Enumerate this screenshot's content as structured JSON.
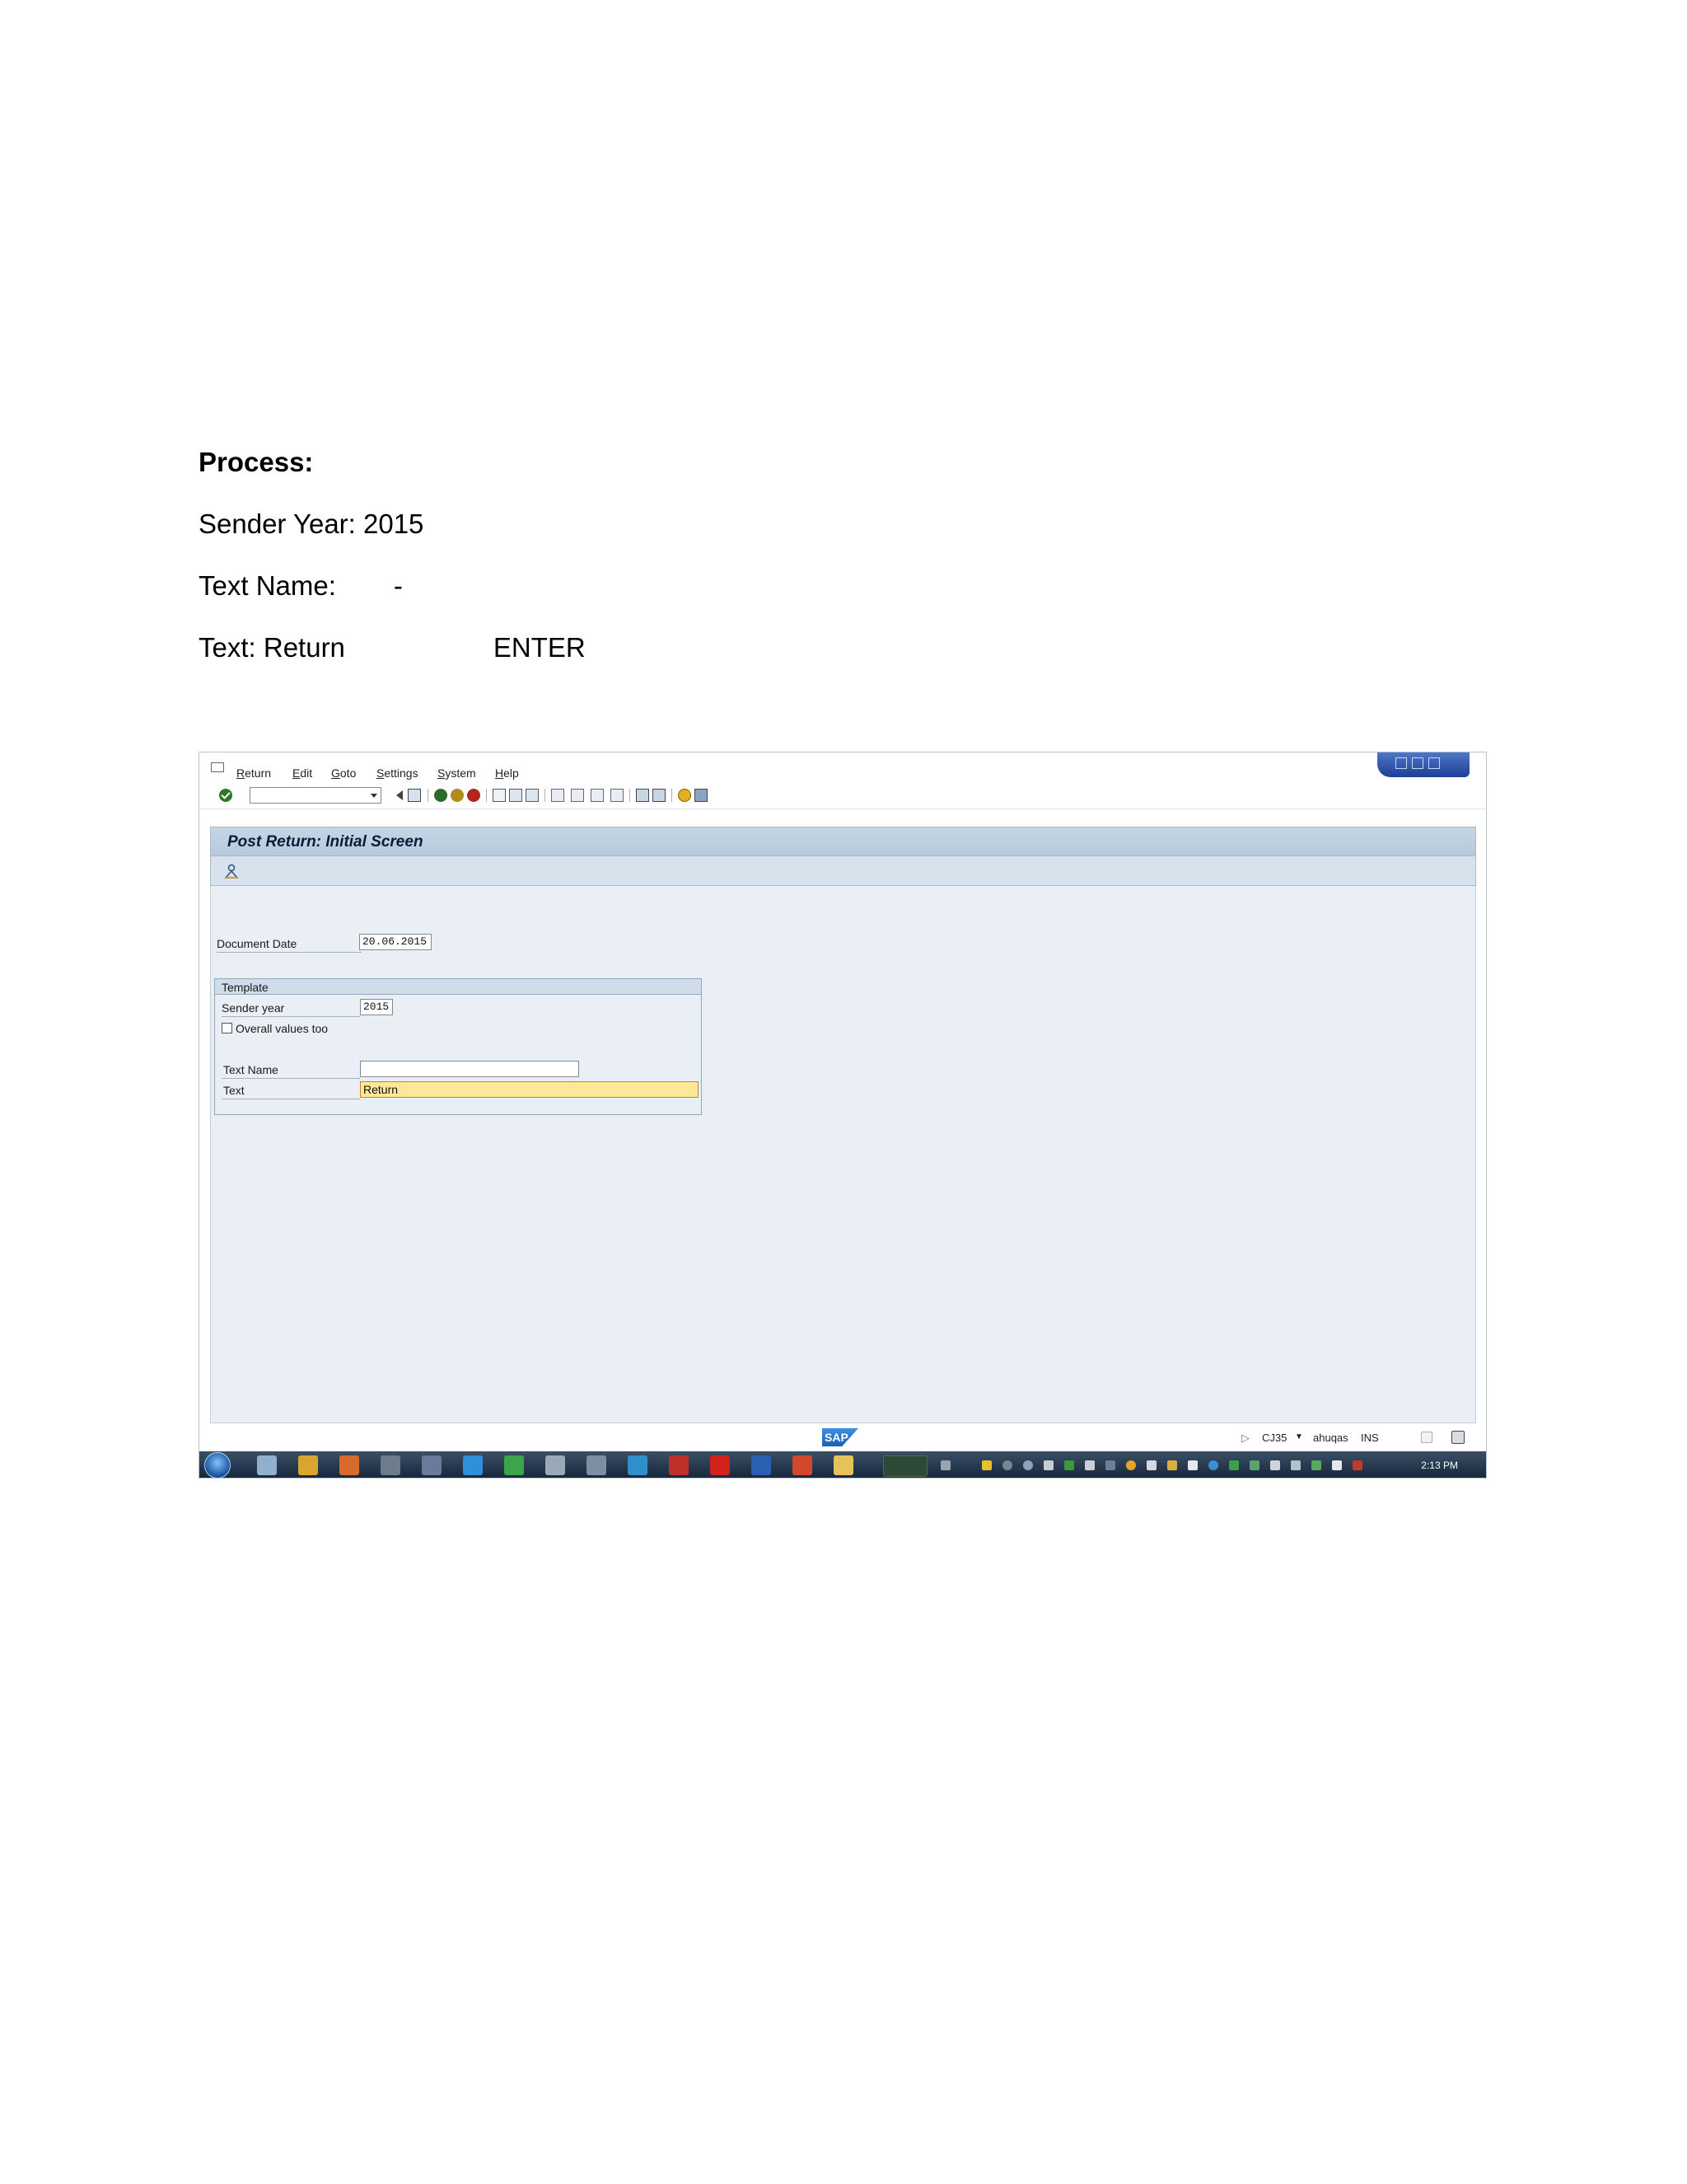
{
  "doc": {
    "heading": "Process:",
    "line1": "Sender Year: 2015",
    "line2_label": "Text Name:",
    "line2_value": "-",
    "line3_label": "Text: Return",
    "line3_action": "ENTER"
  },
  "sap": {
    "menu": [
      "Return",
      "Edit",
      "Goto",
      "Settings",
      "System",
      "Help"
    ],
    "window_title": "Post Return: Initial Screen",
    "document_date_label": "Document Date",
    "document_date_value": "20.06.2015",
    "template_group_title": "Template",
    "sender_year_label": "Sender year",
    "sender_year_value": "2015",
    "overall_values_label": "Overall values too",
    "overall_values_checked": false,
    "text_name_label": "Text Name",
    "text_name_value": "",
    "text_label": "Text",
    "text_value": "Return",
    "status": {
      "transaction": "CJ35",
      "user": "ahuqas",
      "mode": "INS"
    },
    "logo_text": "SAP",
    "clock": "2:13 PM"
  },
  "colors": {
    "title_bar": "#c5d6e6",
    "work_area": "#eaeff5",
    "focus_field": "#fde89a",
    "taskbar": "#16263a"
  }
}
